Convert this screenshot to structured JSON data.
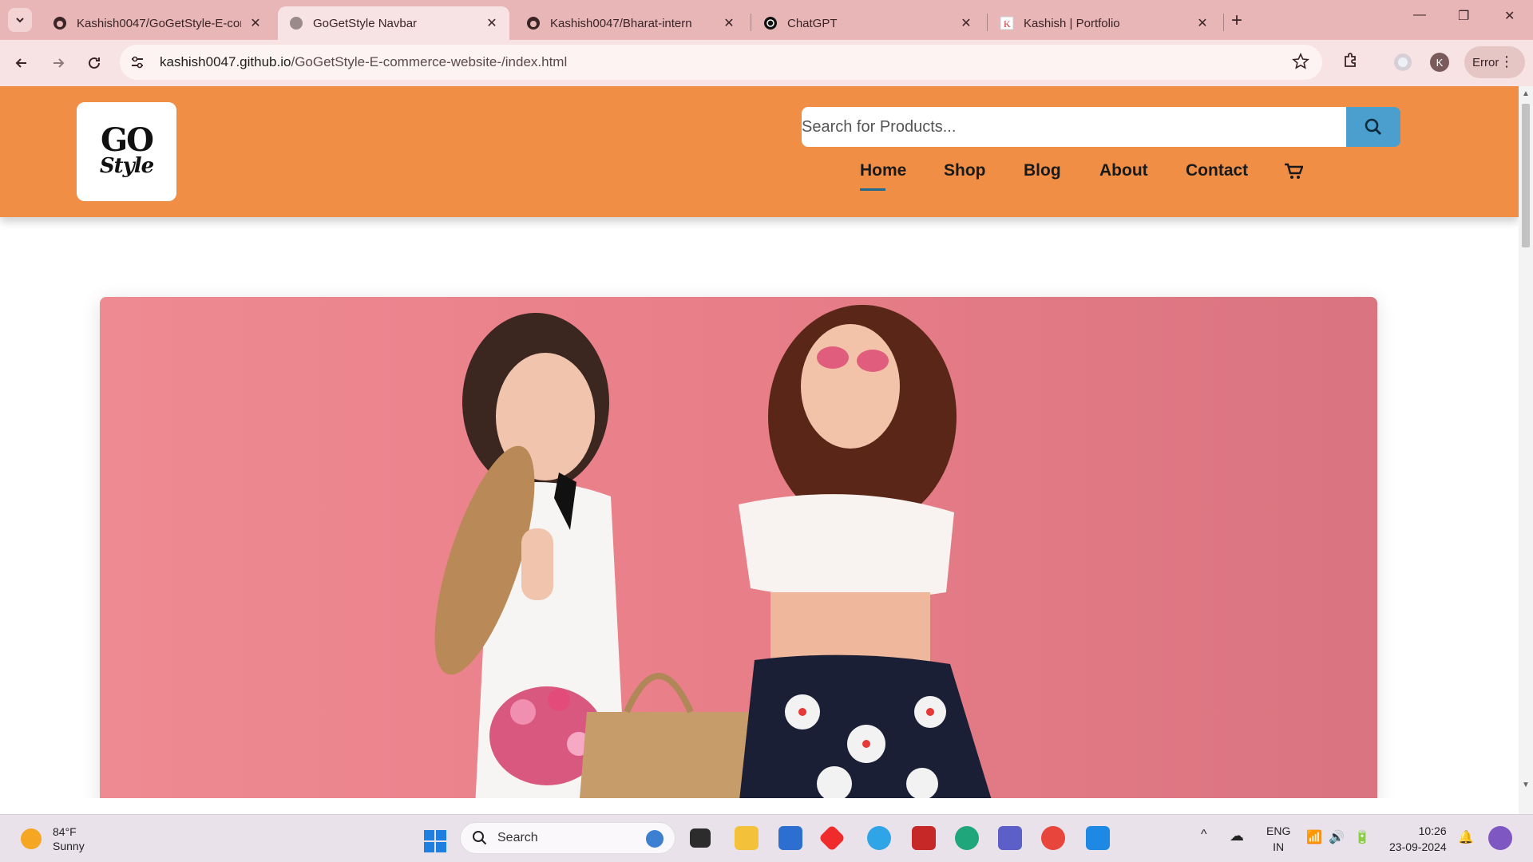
{
  "browser": {
    "tabs": [
      {
        "title": "Kashish0047/GoGetStyle-E-com",
        "icon": "github-icon",
        "active": false
      },
      {
        "title": "GoGetStyle Navbar",
        "icon": "globe-icon",
        "active": true
      },
      {
        "title": "Kashish0047/Bharat-intern",
        "icon": "github-icon",
        "active": false
      },
      {
        "title": "ChatGPT",
        "icon": "chatgpt-icon",
        "active": false
      },
      {
        "title": "Kashish | Portfolio",
        "icon": "portfolio-icon",
        "active": false
      }
    ],
    "url_host": "kashish0047.github.io",
    "url_path": "/GoGetStyle-E-commerce-website-/index.html",
    "profile_initial": "K",
    "error_label": "Error"
  },
  "site": {
    "logo_top": "GO",
    "logo_bottom": "Style",
    "search_placeholder": "Search for Products...",
    "nav": [
      "Home",
      "Shop",
      "Blog",
      "About",
      "Contact"
    ],
    "active_nav": "Home",
    "brand_color": "#f08e46",
    "search_button_color": "#4a9fcf"
  },
  "taskbar": {
    "temperature": "84°F",
    "condition": "Sunny",
    "search_label": "Search",
    "lang_top": "ENG",
    "lang_bottom": "IN",
    "time": "10:26",
    "date": "23-09-2024"
  }
}
